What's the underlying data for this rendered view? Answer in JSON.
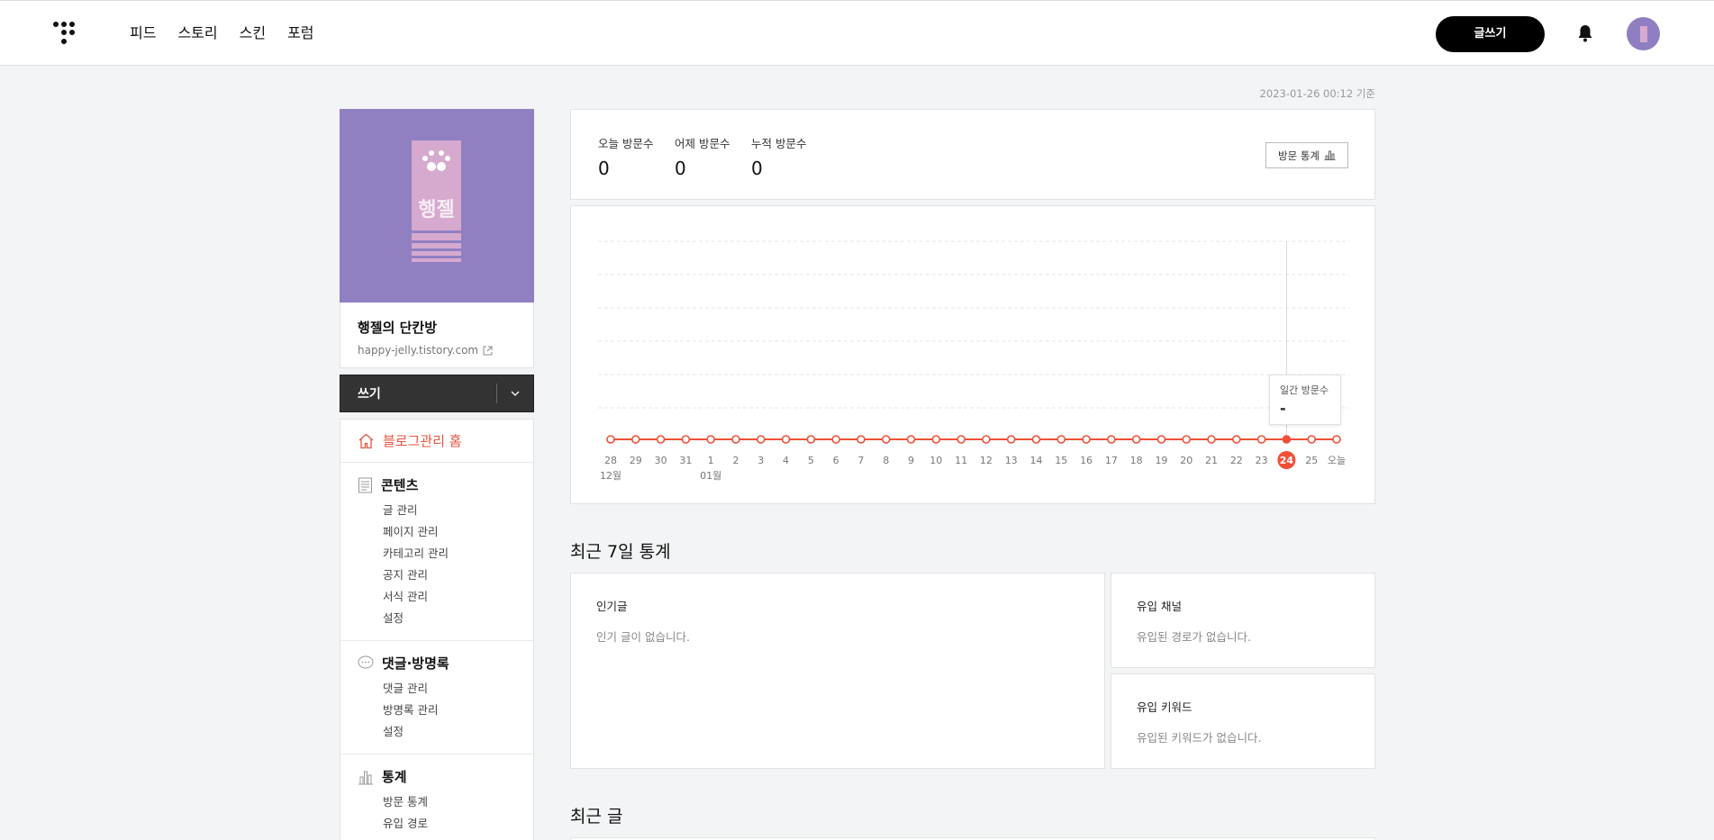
{
  "header": {
    "nav": [
      "피드",
      "스토리",
      "스킨",
      "포럼"
    ],
    "write_label": "글쓰기"
  },
  "sidebar": {
    "blog_name": "행젤의 단칸방",
    "blog_url": "happy-jelly.tistory.com",
    "cover_text": "행젤",
    "write_bar_label": "쓰기",
    "home_label": "블로그관리 홈",
    "sections": [
      {
        "title": "콘텐츠",
        "icon": "document-icon",
        "items": [
          "글 관리",
          "페이지 관리",
          "카테고리 관리",
          "공지 관리",
          "서식 관리",
          "설정"
        ]
      },
      {
        "title": "댓글·방명록",
        "icon": "speech-bubble-icon",
        "items": [
          "댓글 관리",
          "방명록 관리",
          "설정"
        ]
      },
      {
        "title": "통계",
        "icon": "bar-chart-icon",
        "items": [
          "방문 통계",
          "유입 경로"
        ]
      }
    ]
  },
  "main": {
    "timestamp": "2023-01-26 00:12 기준",
    "visits": [
      {
        "label": "오늘 방문수",
        "value": "0"
      },
      {
        "label": "어제 방문수",
        "value": "0"
      },
      {
        "label": "누적 방문수",
        "value": "0"
      }
    ],
    "stats_button": "방문 통계",
    "tooltip": {
      "label": "일간 방문수",
      "value": "-"
    },
    "recent7_title": "최근 7일 통계",
    "popular": {
      "title": "인기글",
      "empty": "인기 글이 없습니다."
    },
    "channel": {
      "title": "유입 채널",
      "empty": "유입된 경로가 없습니다."
    },
    "keyword": {
      "title": "유입 키워드",
      "empty": "유입된 키워드가 없습니다."
    },
    "recent_posts_title": "최근 글"
  },
  "chart_data": {
    "type": "line",
    "x": [
      "28",
      "29",
      "30",
      "31",
      "1",
      "2",
      "3",
      "4",
      "5",
      "6",
      "7",
      "8",
      "9",
      "10",
      "11",
      "12",
      "13",
      "14",
      "15",
      "16",
      "17",
      "18",
      "19",
      "20",
      "21",
      "22",
      "23",
      "24",
      "25",
      "오늘"
    ],
    "month_labels": [
      {
        "at": "28",
        "label": "12월"
      },
      {
        "at": "1",
        "label": "01월"
      }
    ],
    "values": [
      0,
      0,
      0,
      0,
      0,
      0,
      0,
      0,
      0,
      0,
      0,
      0,
      0,
      0,
      0,
      0,
      0,
      0,
      0,
      0,
      0,
      0,
      0,
      0,
      0,
      0,
      0,
      0,
      0,
      0
    ],
    "highlight": "24",
    "ylabel": "",
    "grid": true,
    "colors": {
      "line": "#ef5138",
      "highlight": "#ef5138"
    }
  }
}
